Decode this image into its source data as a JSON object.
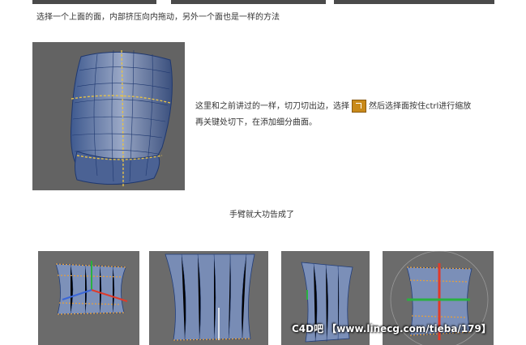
{
  "intro": "选择一个上面的面，内部挤压向内拖动，另外一个面也是一样的方法",
  "description_line1_a": "这里和之前讲过的一样，切刀切出边，选择",
  "description_line1_b": "然后选择面按住ctrl进行缩放",
  "description_line2": "再关键处切下，在添加细分曲面。",
  "caption": "手臂就大功告成了",
  "watermark": "C4D吧 【www.linecg.com/tieba/179】",
  "icon_name": "knife-tool-icon",
  "colors": {
    "panel_bg": "#6b6b6b",
    "mesh": "#2a4a8a",
    "mesh_fill": "#7c90b8",
    "axis_x": "#e03a2a",
    "axis_y": "#2ab040",
    "accent": "#c98a1a"
  }
}
